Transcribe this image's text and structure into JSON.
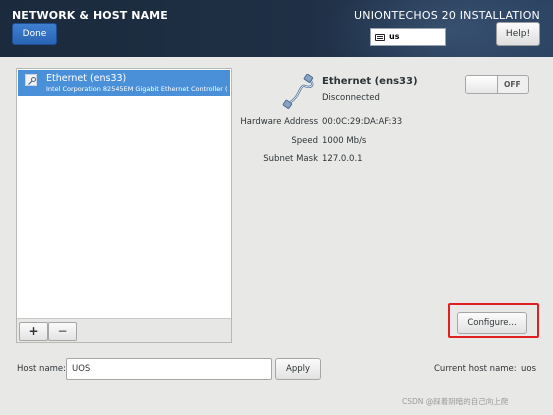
{
  "header": {
    "title": "NETWORK & HOST NAME",
    "done_label": "Done",
    "install_title": "UNIONTECHOS 20 INSTALLATION",
    "keyboard_layout": "us",
    "help_label": "Help!"
  },
  "device_list": {
    "items": [
      {
        "name": "Ethernet (ens33)",
        "description": "Intel Corporation 82545EM Gigabit Ethernet Controller (",
        "selected": true
      }
    ],
    "add_label": "+",
    "remove_label": "−"
  },
  "device_detail": {
    "name": "Ethernet (ens33)",
    "status": "Disconnected",
    "toggle_label": "OFF",
    "properties": [
      {
        "label": "Hardware Address",
        "value": "00:0C:29:DA:AF:33"
      },
      {
        "label": "Speed",
        "value": "1000 Mb/s"
      },
      {
        "label": "Subnet Mask",
        "value": "127.0.0.1"
      }
    ],
    "configure_label": "Configure..."
  },
  "hostname": {
    "label": "Host name:",
    "value": "UOS",
    "apply_label": "Apply",
    "current_label": "Current host name:",
    "current_value": "uos"
  },
  "watermark": "CSDN @踩着阴暗的自己向上爬",
  "colors": {
    "header_bg": "#1f3046",
    "selection": "#4a90d9",
    "done_button": "#3473c4",
    "highlight": "#e02020"
  },
  "icons": {
    "device_row": "network-wired-icon",
    "device_detail": "ethernet-cable-icon",
    "keyboard": "keyboard-icon"
  }
}
